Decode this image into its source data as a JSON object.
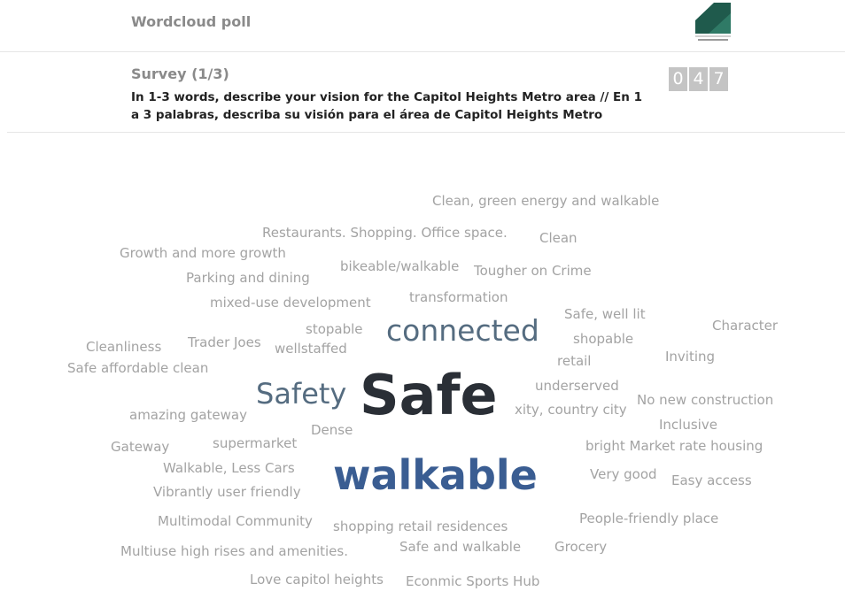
{
  "app": {
    "title": "Wordcloud poll"
  },
  "logo": {
    "caption_line1": "PRINCE GEORGE'S COUNTY",
    "caption_line2": "Planning Department"
  },
  "question": {
    "survey_label": "Survey (1/3)",
    "text": "In 1-3 words, describe your vision for the Capitol Heights Metro area // En 1 a 3 palabras, describa su visión para el área de Capitol Heights Metro"
  },
  "response_count": {
    "digits": [
      "0",
      "4",
      "7"
    ]
  },
  "colors": {
    "primary_word": "#2a2f36",
    "secondary_word": "#3a5d92",
    "tertiary_word": "#556c80",
    "minor_word": "#a3a3a3",
    "counter_bg": "#c4c4c4"
  },
  "words": [
    "Clean, green energy and walkable",
    "Restaurants. Shopping. Office space.",
    "Clean",
    "Growth and more growth",
    "bikeable/walkable",
    "Tougher on Crime",
    "Parking and dining",
    "transformation",
    "mixed-use development",
    "Safe, well lit",
    "stopable",
    "connected",
    "Character",
    "Cleanliness",
    "Trader Joes",
    "wellstaffed",
    "shopable",
    "Inviting",
    "Safe affordable clean",
    "retail",
    "Safety",
    "Safe",
    "underserved",
    "No new construction",
    "amazing gateway",
    "xity, country city",
    "Inclusive",
    "Dense",
    "Gateway",
    "supermarket",
    "bright Market rate housing",
    "Walkable, Less Cars",
    "walkable",
    "Very good",
    "Easy access",
    "Vibrantly user friendly",
    "Multimodal Community",
    "shopping retail residences",
    "People-friendly place",
    "Multiuse high rises and amenities.",
    "Safe and walkable",
    "Grocery",
    "Love capitol heights",
    "Econmic Sports Hub"
  ]
}
